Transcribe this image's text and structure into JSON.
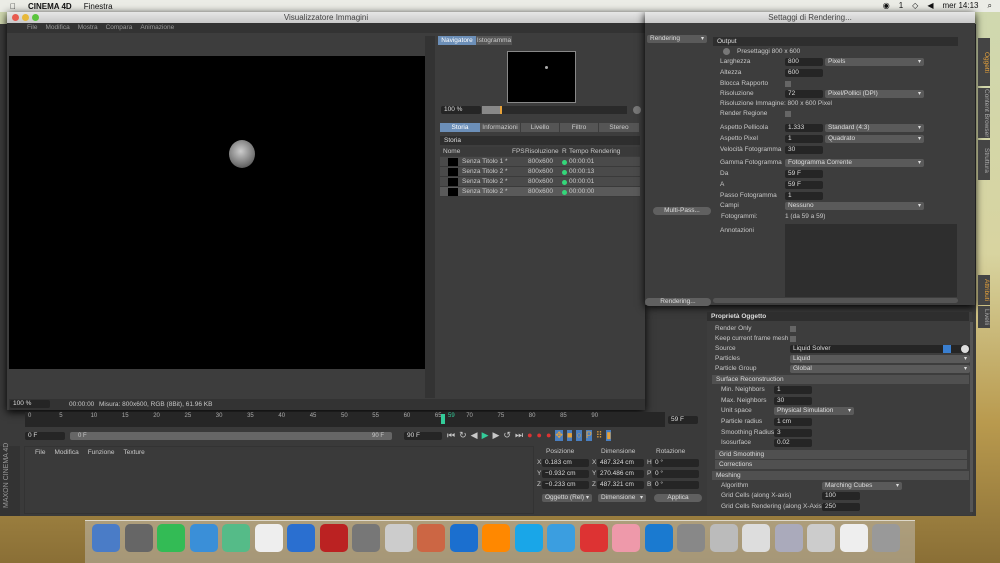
{
  "menubar": {
    "app": "CINEMA 4D",
    "items": [
      "Finestra"
    ],
    "clock": "mer 14:13",
    "status": "1"
  },
  "viewer": {
    "title": "Visualizzatore Immagini",
    "menu": [
      "File",
      "Modifica",
      "Mostra",
      "Compara",
      "Animazione"
    ],
    "nav_tabs": [
      "Navigatore",
      "Istogramma"
    ],
    "zoom": "100 %",
    "tabs": [
      "Storia",
      "Informazioni",
      "Livello",
      "Filtro",
      "Stereo"
    ],
    "history_title": "Storia",
    "columns": [
      "Nome",
      "FPS",
      "Risoluzione",
      "R",
      "Tempo Rendering"
    ],
    "rows": [
      {
        "name": "Senza Titolo 1 *",
        "res": "800x600",
        "time": "00:00:01"
      },
      {
        "name": "Senza Titolo 2 *",
        "res": "800x600",
        "time": "00:00:13"
      },
      {
        "name": "Senza Titolo 2 *",
        "res": "800x600",
        "time": "00:00:01"
      },
      {
        "name": "Senza Titolo 2 *",
        "res": "800x600",
        "time": "00:00:00"
      }
    ],
    "status_zoom": "100 %",
    "status_time": "00:00:00",
    "status_info": "Misura: 800x600, RGB (8Bit), 61.96 KB",
    "nav_progress": 0.14
  },
  "render": {
    "title": "Settaggi di Rendering...",
    "renderer": "Rendering",
    "multipass": "Multi-Pass...",
    "render_btn": "Rendering...",
    "top_dd": "vio",
    "output": "Output",
    "preset": "Presettaggi 800 x 600",
    "fields": {
      "larghezza": "Larghezza",
      "larghezza_v": "800",
      "unit": "Pixels",
      "altezza": "Altezza",
      "altezza_v": "600",
      "blocca": "Blocca Rapporto",
      "risoluzione": "Risoluzione",
      "risoluzione_v": "72",
      "risunit": "Pixel/Pollici (DPI)",
      "risimg": "Risoluzione Immagine: 800 x 600 Pixel",
      "regione": "Render Regione",
      "pellicola": "Aspetto Pellicola",
      "pellicola_v": "1.333",
      "pellicola_dd": "Standard (4:3)",
      "pixel": "Aspetto Pixel",
      "pixel_v": "1",
      "pixel_dd": "Quadrato",
      "velocita": "Velocità Fotogramma",
      "velocita_v": "30",
      "gamma": "Gamma Fotogramma",
      "gamma_dd": "Fotogramma Corrente",
      "da": "Da",
      "da_v": "59 F",
      "a": "A",
      "a_v": "59 F",
      "passo": "Passo Fotogramma",
      "passo_v": "1",
      "campi": "Campi",
      "campi_dd": "Nessuno",
      "fotogrammi": "Fotogrammi:",
      "fotogrammi_v": "1 (da 59 a 59)",
      "annotazioni": "Annotazioni"
    }
  },
  "side_tabs": [
    "Oggetti",
    "Content Browser",
    "Struttura",
    "Attributi",
    "Livelli"
  ],
  "attr": {
    "title": "Proprietà Oggetto",
    "render_only": "Render Only",
    "keep": "Keep current frame mesh",
    "source": "Source",
    "source_v": "Liquid Solver",
    "particles": "Particles",
    "particles_v": "Liquid",
    "group": "Particle Group",
    "group_v": "Global",
    "surface": "Surface Reconstruction",
    "min": "Min. Neighbors",
    "min_v": "1",
    "max": "Max. Neighbors",
    "max_v": "30",
    "unit": "Unit space",
    "unit_v": "Physical Simulation",
    "radius": "Particle radius",
    "radius_v": "1 cm",
    "smooth": "Smoothing Radius",
    "smooth_v": "3",
    "iso": "Isosurface",
    "iso_v": "0.02",
    "grid_smoothing": "Grid Smoothing",
    "corrections": "Corrections",
    "meshing": "Meshing",
    "algo": "Algorithm",
    "algo_v": "Marching Cubes",
    "cells": "Grid Cells (along X-axis)",
    "cells_v": "100",
    "cells_r": "Grid Cells Rendering (along X-Axis)",
    "cells_r_v": "250"
  },
  "timeline": {
    "ticks": [
      "0",
      "5",
      "10",
      "15",
      "20",
      "25",
      "30",
      "35",
      "40",
      "45",
      "50",
      "55",
      "60",
      "65",
      "70",
      "75",
      "80",
      "85",
      "90"
    ],
    "current": "59",
    "current_field": "59 F",
    "start": "0 F",
    "range_start": "0 F",
    "range_end": "90 F",
    "end": "90 F"
  },
  "materials": {
    "menu": [
      "File",
      "Modifica",
      "Funzione",
      "Texture"
    ]
  },
  "coords": {
    "headers": [
      "Posizione",
      "Dimensione",
      "Rotazione"
    ],
    "pos": [
      [
        "X",
        "0.183 cm"
      ],
      [
        "Y",
        "−0.932 cm"
      ],
      [
        "Z",
        "−0.233 cm"
      ]
    ],
    "dim": [
      [
        "X",
        "487.324 cm"
      ],
      [
        "Y",
        "270.486 cm"
      ],
      [
        "Z",
        "487.321 cm"
      ]
    ],
    "rot": [
      [
        "H",
        "0 °"
      ],
      [
        "P",
        "0 °"
      ],
      [
        "B",
        "0 °"
      ]
    ],
    "mode": "Oggetto (Rel)",
    "dim_mode": "Dimensione",
    "apply": "Applica"
  },
  "brand": "MAXON CINEMA 4D",
  "dock_colors": [
    "#4a7cc7",
    "#666",
    "#3b5",
    "#3a8fd8",
    "#5b8",
    "#eee",
    "#2a6fd0",
    "#b22",
    "#777",
    "#ccc",
    "#c64",
    "#1b6fcf",
    "#f80",
    "#19a6e8",
    "#3b9ee0",
    "#d33",
    "#e9a",
    "#1a7ad0",
    "#888",
    "#bbb",
    "#ddd",
    "#aab",
    "#ccc",
    "#eee",
    "#999"
  ]
}
